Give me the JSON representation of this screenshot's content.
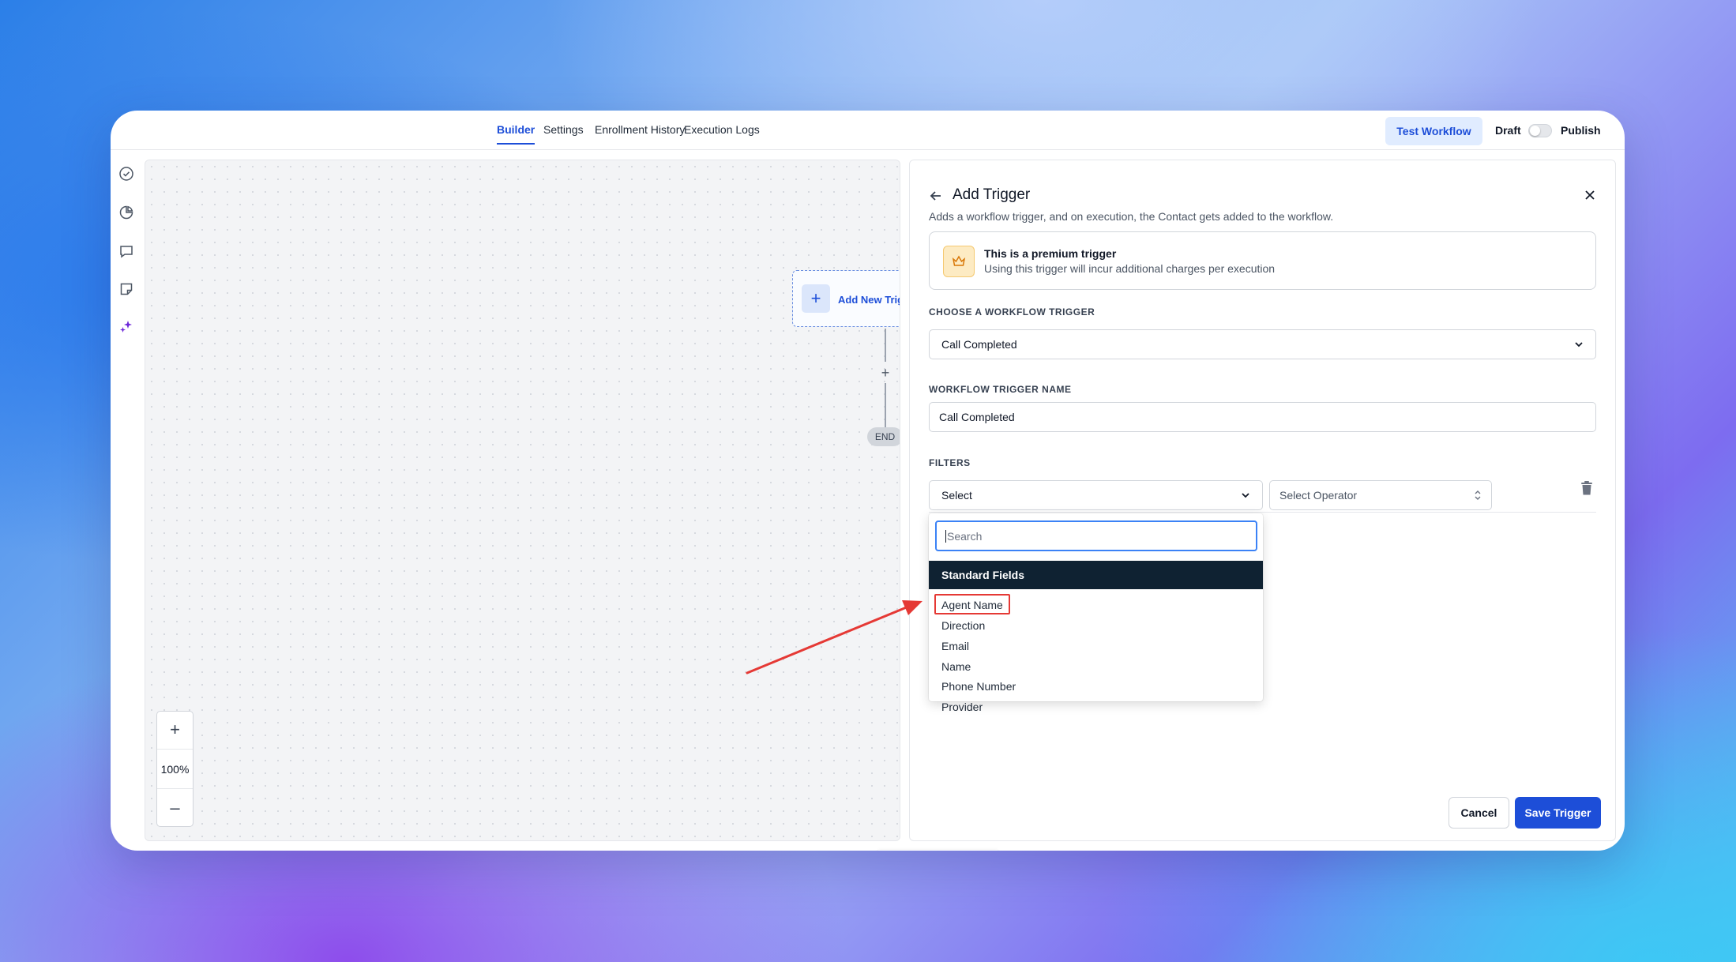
{
  "nav": {
    "tabs": [
      {
        "label": "Builder",
        "active": true
      },
      {
        "label": "Settings"
      },
      {
        "label": "Enrollment History"
      },
      {
        "label": "Execution Logs"
      }
    ],
    "test_workflow": "Test Workflow",
    "draft": "Draft",
    "publish": "Publish",
    "published": false
  },
  "rail": {
    "icons": [
      "check-circle-icon",
      "pie-chart-icon",
      "comment-icon",
      "sticky-note-icon",
      "sparkles-icon"
    ]
  },
  "canvas": {
    "trigger_node_label": "Add New Trig",
    "add_step": "+",
    "end_label": "END",
    "zoom_in": "+",
    "zoom_level": "100%",
    "zoom_out": "–"
  },
  "panel": {
    "title": "Add Trigger",
    "description": "Adds a workflow trigger, and on execution, the Contact gets added to the workflow.",
    "premium_title": "This is a premium trigger",
    "premium_subtitle": "Using this trigger will incur additional charges per execution",
    "choose_label": "CHOOSE A WORKFLOW TRIGGER",
    "trigger_value": "Call Completed",
    "name_label": "WORKFLOW TRIGGER NAME",
    "name_value": "Call Completed",
    "filters_label": "FILTERS",
    "filter_field": "Select",
    "filter_operator": "Select Operator",
    "cancel": "Cancel",
    "save": "Save Trigger"
  },
  "dropdown": {
    "search_placeholder": "Search",
    "group": "Standard Fields",
    "items": [
      "Agent Name",
      "Direction",
      "Email",
      "Name",
      "Phone Number",
      "Provider"
    ],
    "highlighted_item": "Agent Name"
  },
  "colors": {
    "accent": "#1d4ed8",
    "group_header": "#0f2232",
    "annotation": "#e53935"
  }
}
